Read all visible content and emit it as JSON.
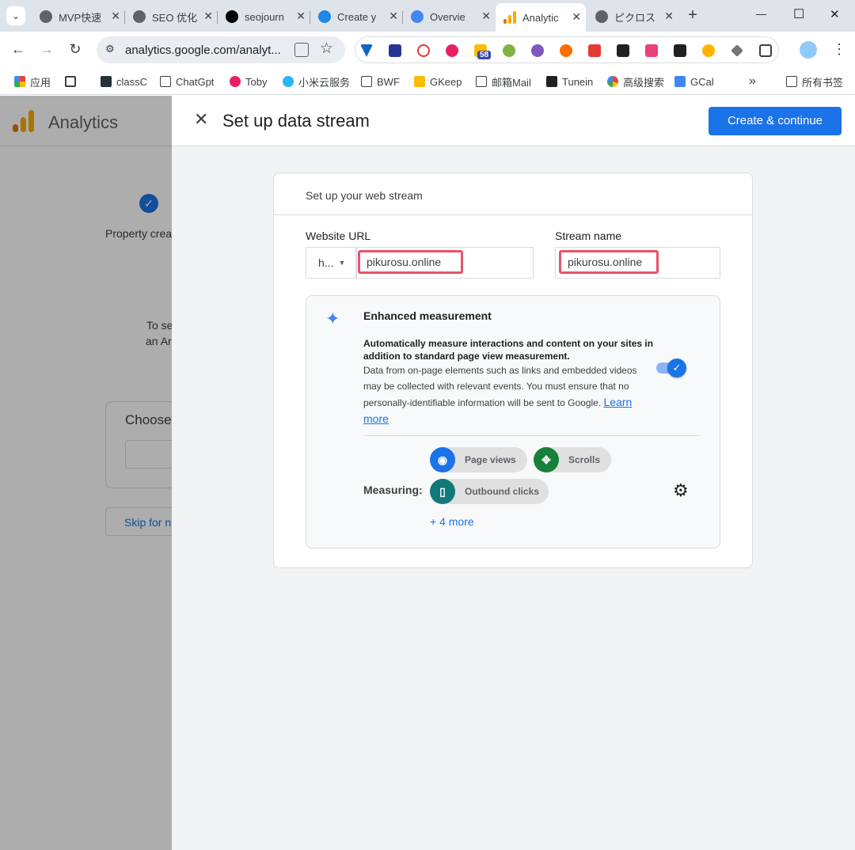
{
  "browser": {
    "tabs": [
      {
        "title": "MVP快速"
      },
      {
        "title": "SEO 优化"
      },
      {
        "title": "seojourn"
      },
      {
        "title": "Create y"
      },
      {
        "title": "Overvie"
      },
      {
        "title": "Analytic"
      },
      {
        "title": "ピクロス"
      }
    ],
    "new_tab": "+",
    "window_controls": {
      "minimize": "—",
      "maximize": "☐",
      "close": "✕"
    },
    "url": "analytics.google.com/analyt...",
    "extension_badge": "58",
    "bookmarks": [
      {
        "label": "应用"
      },
      {
        "label": ""
      },
      {
        "label": "classC"
      },
      {
        "label": "ChatGpt"
      },
      {
        "label": "Toby"
      },
      {
        "label": "小米云服务"
      },
      {
        "label": "BWF"
      },
      {
        "label": "GKeep"
      },
      {
        "label": "邮箱Mail"
      },
      {
        "label": "Tunein"
      },
      {
        "label": "高级搜索"
      },
      {
        "label": "GCal"
      }
    ],
    "bookmarks_more": "»",
    "all_bookmarks": "所有书签"
  },
  "background_page": {
    "app_name": "Analytics",
    "step_label": "Property crea",
    "text_line1": "To se",
    "text_line2": "an Ar",
    "choose_label": "Choose",
    "skip_label": "Skip for n"
  },
  "panel": {
    "title": "Set up data stream",
    "create_button": "Create & continue",
    "card_title": "Set up your web stream",
    "website_url_label": "Website URL",
    "protocol_value": "h...",
    "website_url_value": "pikurosu.online",
    "stream_name_label": "Stream name",
    "stream_name_value": "pikurosu.online",
    "enhanced": {
      "title": "Enhanced measurement",
      "desc_bold": "Automatically measure interactions and content on your sites in addition to standard page view measurement.",
      "desc": "Data from on-page elements such as links and embedded videos may be collected with relevant events. You must ensure that no personally-identifiable information will be sent to Google.",
      "learn_more": "Learn more",
      "toggle_on": true,
      "measuring_label": "Measuring:",
      "chips": [
        {
          "label": "Page views",
          "color": "#1a73e8",
          "icon": "eye-icon"
        },
        {
          "label": "Scrolls",
          "color": "#188038",
          "icon": "scroll-arrows-icon"
        },
        {
          "label": "Outbound clicks",
          "color": "#12797a",
          "icon": "mouse-icon"
        }
      ],
      "more_link": "+ 4 more"
    }
  },
  "colors": {
    "primary": "#1a73e8",
    "highlight": "#e8546a",
    "analytics_orange": "#f9ab00"
  }
}
